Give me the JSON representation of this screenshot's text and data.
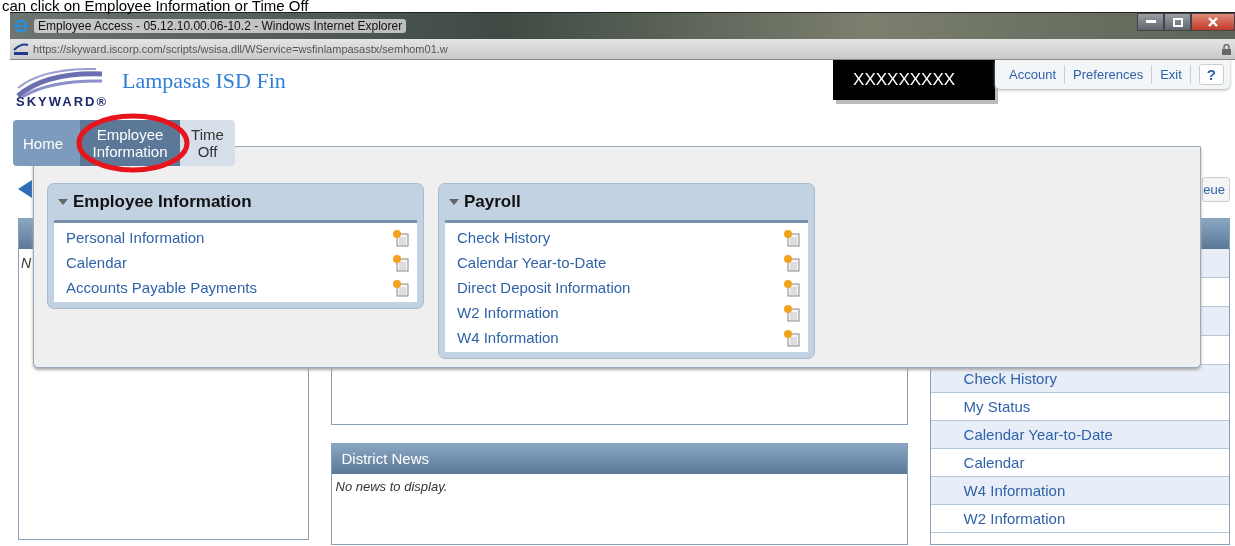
{
  "caption": "can click on Employee Information or Time Off",
  "window": {
    "title": "Employee Access - 05.12.10.00.06-10.2 - Windows Internet Explorer",
    "url": "https://skyward.iscorp.com/scripts/wsisa.dll/WService=wsfinlampasastx/semhom01.w"
  },
  "header": {
    "logo": "SKYWARD®",
    "site_title": "Lampasas ISD Fin",
    "user_name": "XXXXXXXXX",
    "links": [
      "Account",
      "Preferences",
      "Exit"
    ],
    "help": "?"
  },
  "nav_tabs": [
    {
      "label": "Home",
      "selected": false,
      "highlighted": false
    },
    {
      "label": "Employee Information",
      "selected": true,
      "highlighted": true
    },
    {
      "label": "Time Off",
      "selected": false,
      "highlighted": false
    }
  ],
  "dropdown_menus": [
    {
      "title": "Employee Information",
      "expanded": true,
      "items": [
        "Personal Information",
        "Calendar",
        "Accounts Payable Payments"
      ]
    },
    {
      "title": "Payroll",
      "expanded": true,
      "items": [
        "Check History",
        "Calendar Year-to-Date",
        "Direct Deposit Information",
        "W2 Information",
        "W4 Information"
      ]
    }
  ],
  "toolbar_button": "eue",
  "left_panel": {
    "text": "N"
  },
  "district_news": {
    "title": "District News",
    "message": "No news to display."
  },
  "quick_links": [
    {
      "label": "Check History"
    },
    {
      "label": "My Status"
    },
    {
      "label": "Calendar Year-to-Date"
    },
    {
      "label": "Calendar"
    },
    {
      "label": "W4 Information"
    },
    {
      "label": "W2 Information"
    }
  ]
}
